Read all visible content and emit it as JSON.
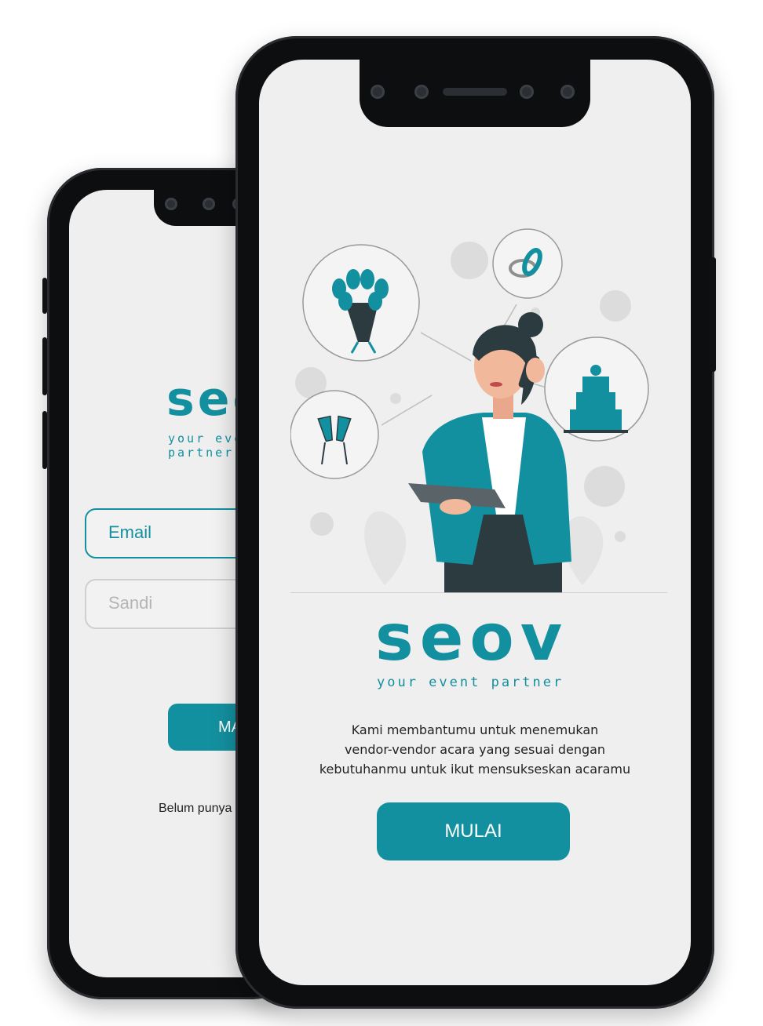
{
  "login_screen": {
    "logo": "seov",
    "tagline": "your event partner",
    "email_value": "Email",
    "password_placeholder": "Sandi",
    "login_button_label": "MASUK",
    "register_prompt": "Belum punya akun?"
  },
  "welcome_screen": {
    "logo": "seov",
    "tagline": "your event partner",
    "description_lines": [
      "Kami membantumu untuk menemukan",
      "vendor-vendor acara yang sesuai dengan",
      "kebutuhanmu untuk ikut mensukseskan acaramu"
    ],
    "start_button_label": "MULAI"
  },
  "colors": {
    "brand": "#13909f",
    "screen_background": "#efefef",
    "phone_frame": "#0d0e10"
  }
}
